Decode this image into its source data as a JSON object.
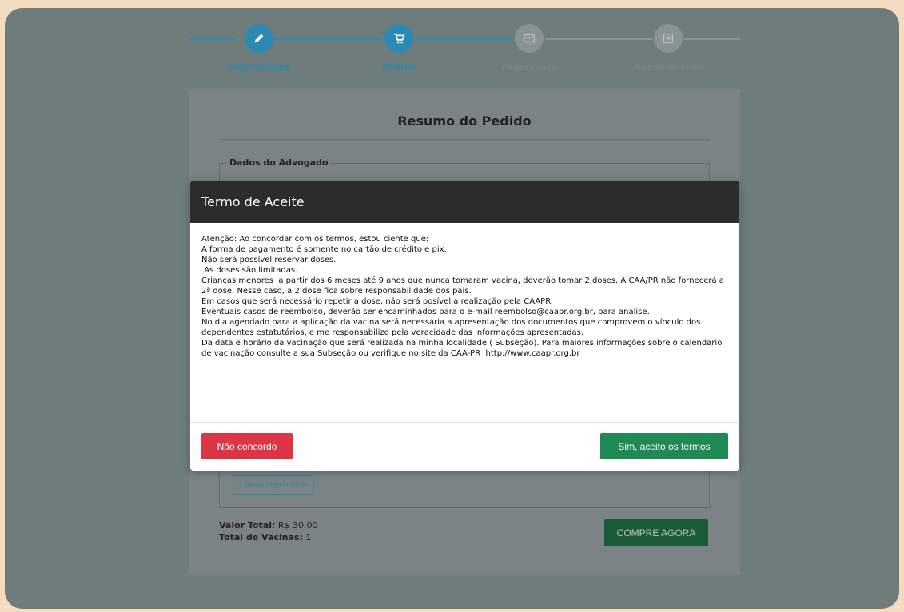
{
  "stepper": {
    "steps": [
      {
        "label": "Informações",
        "icon": "pencil-icon",
        "state": "done"
      },
      {
        "label": "Pedido",
        "icon": "cart-icon",
        "state": "active"
      },
      {
        "label": "Pagamento",
        "icon": "payment-icon",
        "state": "pending"
      },
      {
        "label": "Agendamento",
        "icon": "calendar-icon",
        "state": "pending"
      }
    ]
  },
  "order": {
    "title": "Resumo do Pedido",
    "lawyer_section": "Dados do Advogado",
    "new_dependent": "+ Novo dependente",
    "total_value_label": "Valor Total:",
    "total_value": "R$ 30,00",
    "total_vaccines_label": "Total de Vacinas:",
    "total_vaccines": "1",
    "buy_button": "COMPRE AGORA"
  },
  "modal": {
    "title": "Termo de Aceite",
    "lines": [
      "Atenção: Ao concordar com os termos, estou ciente que:",
      "A forma de pagamento é somente no cartão de crédito e pix.",
      "Não será possível reservar doses.",
      " As doses são limitadas.",
      "Crianças menores  a partir dos 6 meses até 9 anos que nunca tomaram vacina, deverão tomar 2 doses. A CAA/PR não fornecerá a",
      "2ª dose. Nesse caso, a 2 dose fica sobre responsabilidade dos pais.",
      "Em casos que será necessário repetir a dose, não será posível a realização pela CAAPR.",
      "Eventuais casos de reembolso, deverão ser encaminhados para o e-mail reembolso@caapr.org.br, para análise.",
      "No dia agendado para a aplicação da vacina será necessária a apresentação dos documentos que comprovem o vínculo dos dependentes estatutários, e me responsabilizo pela veracidade das informações apresentadas.",
      "Da data e horário da vacinação que será realizada na minha localidade ( Subseção). Para maiores informações sobre o calendario de vacinação consulte a sua Subseção ou verifique no site da CAA-PR  http://www.caapr.org.br"
    ],
    "decline_button": "Não concordo",
    "accept_button": "Sim, aceito os termos"
  },
  "colors": {
    "primary": "#2b89b4",
    "danger": "#dc3545",
    "success": "#1f8a56",
    "modal_header": "#2c2c2c"
  }
}
